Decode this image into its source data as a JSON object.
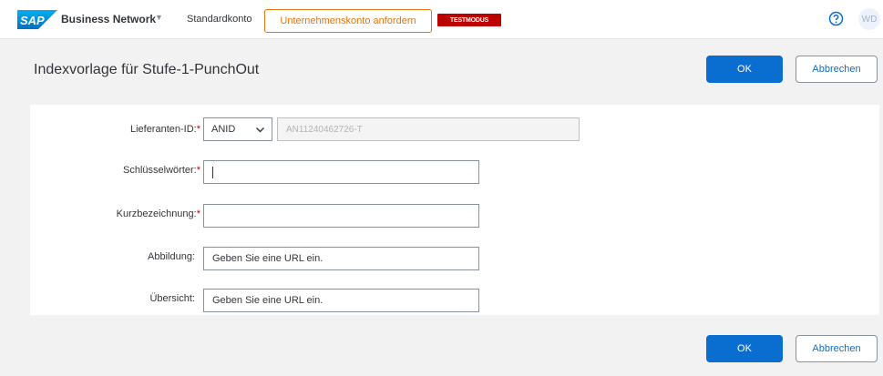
{
  "header": {
    "logo_text": "SAP",
    "brand": "Business Network",
    "account_label": "Standardkonto",
    "request_button": "Unternehmenskonto anfordern",
    "test_badge": "TESTMODUS",
    "help_icon": "help-circle-icon",
    "avatar_initials": "WD",
    "colors": {
      "accent": "#0a6ed1",
      "request_orange": "#e9730c",
      "badge_red": "#bb0000"
    }
  },
  "page": {
    "title": "Indexvorlage für Stufe-1-PunchOut",
    "ok_label": "OK",
    "cancel_label": "Abbrechen"
  },
  "form": {
    "supplier_id": {
      "label": "Lieferanten-ID:",
      "required_mark": "*",
      "type_selected": "ANID",
      "value": "AN11240462726-T"
    },
    "keywords": {
      "label": "Schlüsselwörter:",
      "required_mark": "*",
      "value": ""
    },
    "short_name": {
      "label": "Kurzbezeichnung:",
      "required_mark": "*",
      "value": ""
    },
    "image": {
      "label": "Abbildung:",
      "value": "Geben Sie eine URL ein."
    },
    "overview": {
      "label": "Übersicht:",
      "value": "Geben Sie eine URL ein."
    }
  }
}
